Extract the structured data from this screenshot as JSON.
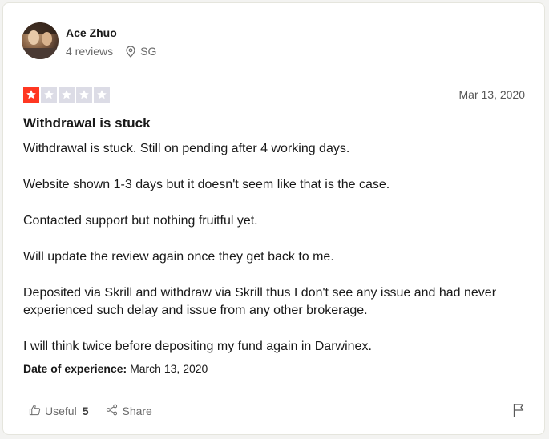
{
  "reviewer": {
    "name": "Ace Zhuo",
    "reviews": "4 reviews",
    "location": "SG"
  },
  "rating": {
    "value": 1,
    "max": 5,
    "active_color": "#ff3722",
    "inactive_color": "#dcdce6"
  },
  "date": "Mar 13, 2020",
  "title": "Withdrawal is stuck",
  "body": {
    "p1": "Withdrawal is stuck. Still on pending after 4 working days.",
    "p2": "Website shown 1-3 days but it doesn't seem like that is the case.",
    "p3": "Contacted support but nothing fruitful yet.",
    "p4": "Will update the review again once they get back to me.",
    "p5": "Deposited via Skrill and withdraw via Skrill thus I don't see any issue and had never experienced such delay and issue from any other brokerage.",
    "p6": "I will think twice before depositing my fund again in Darwinex."
  },
  "experience": {
    "label": "Date of experience:",
    "value": "March 13, 2020"
  },
  "actions": {
    "useful_label": "Useful",
    "useful_count": "5",
    "share_label": "Share"
  },
  "icons": {
    "location": "location-pin-icon",
    "useful": "thumbs-up-icon",
    "share": "share-icon",
    "report": "flag-icon"
  }
}
